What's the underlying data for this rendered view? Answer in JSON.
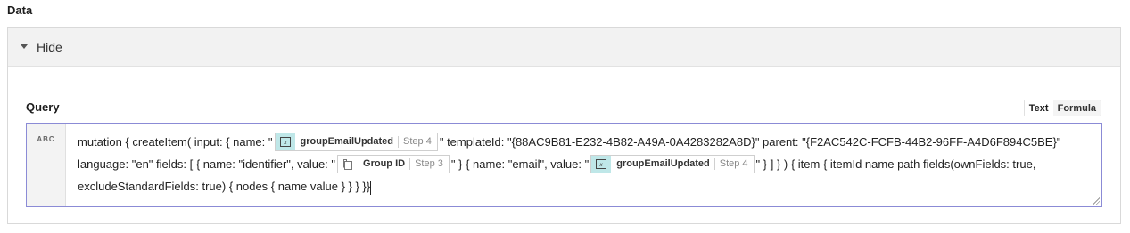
{
  "section": {
    "title": "Data"
  },
  "panel": {
    "toggle_label": "Hide"
  },
  "query": {
    "label": "Query",
    "mode_options": [
      "Text",
      "Formula"
    ],
    "type_badge": "ABC",
    "segments": [
      "mutation { createItem( input: { name: \"",
      "\" templateId: \"{88AC9B81-E232-4B82-A49A-0A4283282A8D}\" parent: \"{F2AC542C-FCFB-44B2-96FF-A4D6F894C5BE}\" language: \"en\" fields: [ { name: \"identifier\", value: \"",
      "\" } { name: \"email\", value: \"",
      "\" } ] } ) { item { itemId name path fields(ownFields: true, excludeStandardFields: true) { nodes { name value } } } }}"
    ],
    "tokens": [
      {
        "name": "groupEmailUpdated",
        "step": "Step 4",
        "icon": "variable-icon"
      },
      {
        "name": "Group ID",
        "step": "Step 3",
        "icon": "copy-icon"
      },
      {
        "name": "groupEmailUpdated",
        "step": "Step 4",
        "icon": "variable-icon"
      }
    ]
  }
}
